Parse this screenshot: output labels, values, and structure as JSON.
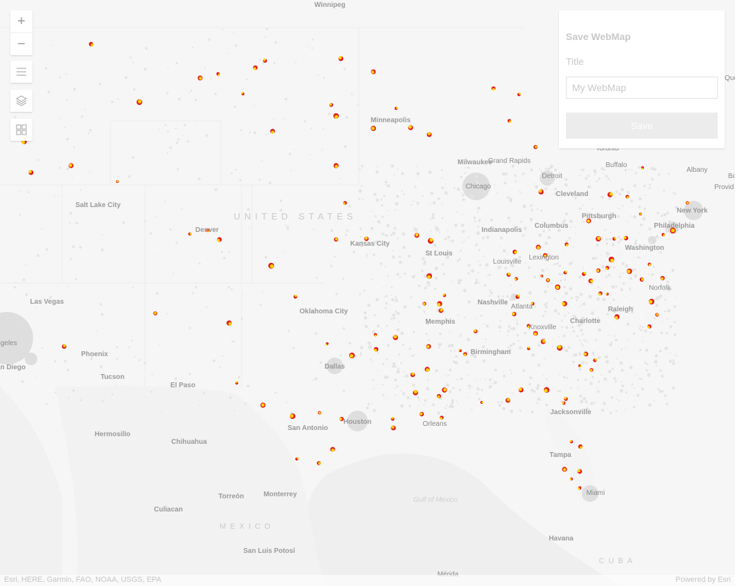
{
  "map": {
    "labels": {
      "winnipeg": "Winnipeg",
      "minneapolis": "Minneapolis",
      "milwaukee": "Milwaukee",
      "detroit": "Detroit",
      "chicago": "Chicago",
      "toronto": "Toronto",
      "buffalo": "Buffalo",
      "albany": "Albany",
      "boston": "Bo",
      "providence": "Provid",
      "quebec": "Qué",
      "cleveland": "Cleveland",
      "pittsburgh": "Pittsburgh",
      "new_york": "New York",
      "philadelphia": "Philadelphia",
      "washington": "Washington",
      "indianapolis": "Indianapolis",
      "columbus": "Columbus",
      "louisville": "Louisville",
      "lexington": "Lexington",
      "grand_rapids": "Grand Rapids",
      "salt_lake_city": "Salt Lake City",
      "denver": "Denver",
      "kansas_city": "Kansas City",
      "st_louis": "St Louis",
      "nashville": "Nashville",
      "knoxville": "Knoxville",
      "charlotte": "Charlotte",
      "raleigh": "Raleigh",
      "norfolk": "Norfolk",
      "las_vegas": "Las Vegas",
      "oklahoma_city": "Oklahoma City",
      "memphis": "Memphis",
      "birmingham": "Birmingham",
      "atlanta": "Atlanta",
      "phoenix": "Phoenix",
      "tucson": "Tucson",
      "el_paso": "El Paso",
      "dallas": "Dallas",
      "san_diego": "an Diego",
      "los_angeles": "ngeles",
      "houston": "Houston",
      "new_orleans": "Orleans",
      "san_antonio": "San Antonio",
      "jacksonville": "Jacksonville",
      "tampa": "Tampa",
      "miami": "Miami",
      "hermosillo": "Hermosillo",
      "chihuahua": "Chihuahua",
      "torreon": "Torreón",
      "monterrey": "Monterrey",
      "culiacan": "Culiacan",
      "san_luis_potosi": "San Luis Potosí",
      "havana": "Havana",
      "merida": "Mérida",
      "united_states": "UNITED STATES",
      "mexico": "MEXICO",
      "cuba": "CUBA",
      "gulf_of_mexico": "Gulf of Mexico"
    }
  },
  "controls": {
    "zoom_in": "+",
    "zoom_out": "−"
  },
  "panel": {
    "title": "Save WebMap",
    "field_label": "Title",
    "input_placeholder": "My WebMap",
    "input_value": "",
    "save_label": "Save"
  },
  "attribution": {
    "sources": "Esri, HERE, Garmin, FAO, NOAA, USGS, EPA",
    "powered_by": "Powered by Esri"
  },
  "colors": {
    "hotspot_red": "#e41a1a",
    "hotspot_yellow": "#ffd400",
    "basemap_bg": "#f7f7f7",
    "land": "#f3f3f3",
    "water": "#fbfbfb"
  }
}
